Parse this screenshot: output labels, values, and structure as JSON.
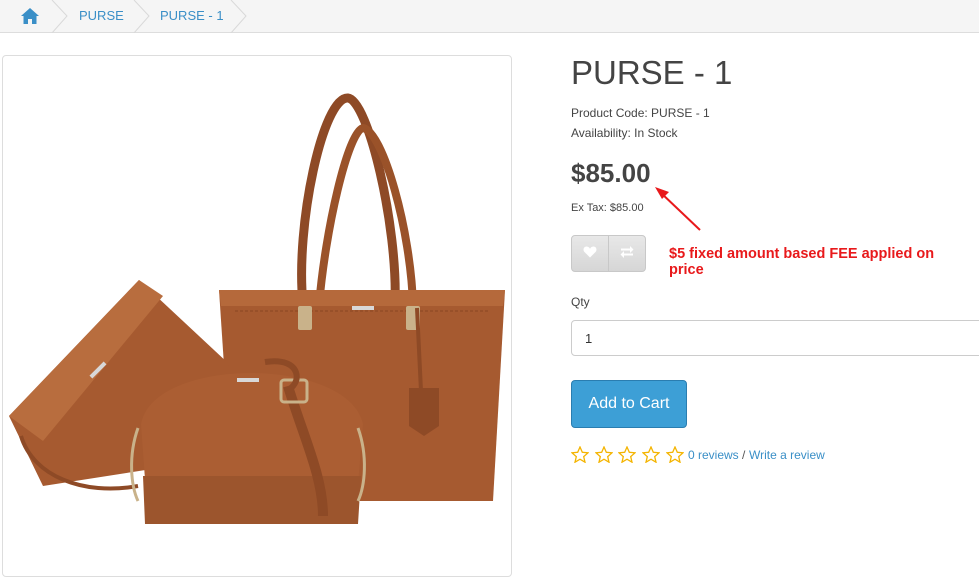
{
  "breadcrumb": {
    "home_icon": "home-icon",
    "items": [
      "PURSE",
      "PURSE - 1"
    ]
  },
  "product": {
    "title": "PURSE - 1",
    "code_line": "Product Code: PURSE - 1",
    "availability_line": "Availability: In Stock",
    "price": "$85.00",
    "ex_tax": "Ex Tax: $85.00",
    "wishlist_icon": "heart-icon",
    "compare_icon": "exchange-icon",
    "qty_label": "Qty",
    "qty_value": "1",
    "add_to_cart": "Add to Cart",
    "rating_stars": 0,
    "rating_max": 5,
    "reviews_link": "0 reviews",
    "review_separator": "/",
    "write_review": "Write a review"
  },
  "annotation": {
    "text": "$5 fixed amount based FEE applied on price",
    "color": "#e8191b"
  },
  "colors": {
    "link": "#3a8fc7",
    "button": "#3d9fd6",
    "star": "#f4b400",
    "leather": "#a65a30"
  }
}
